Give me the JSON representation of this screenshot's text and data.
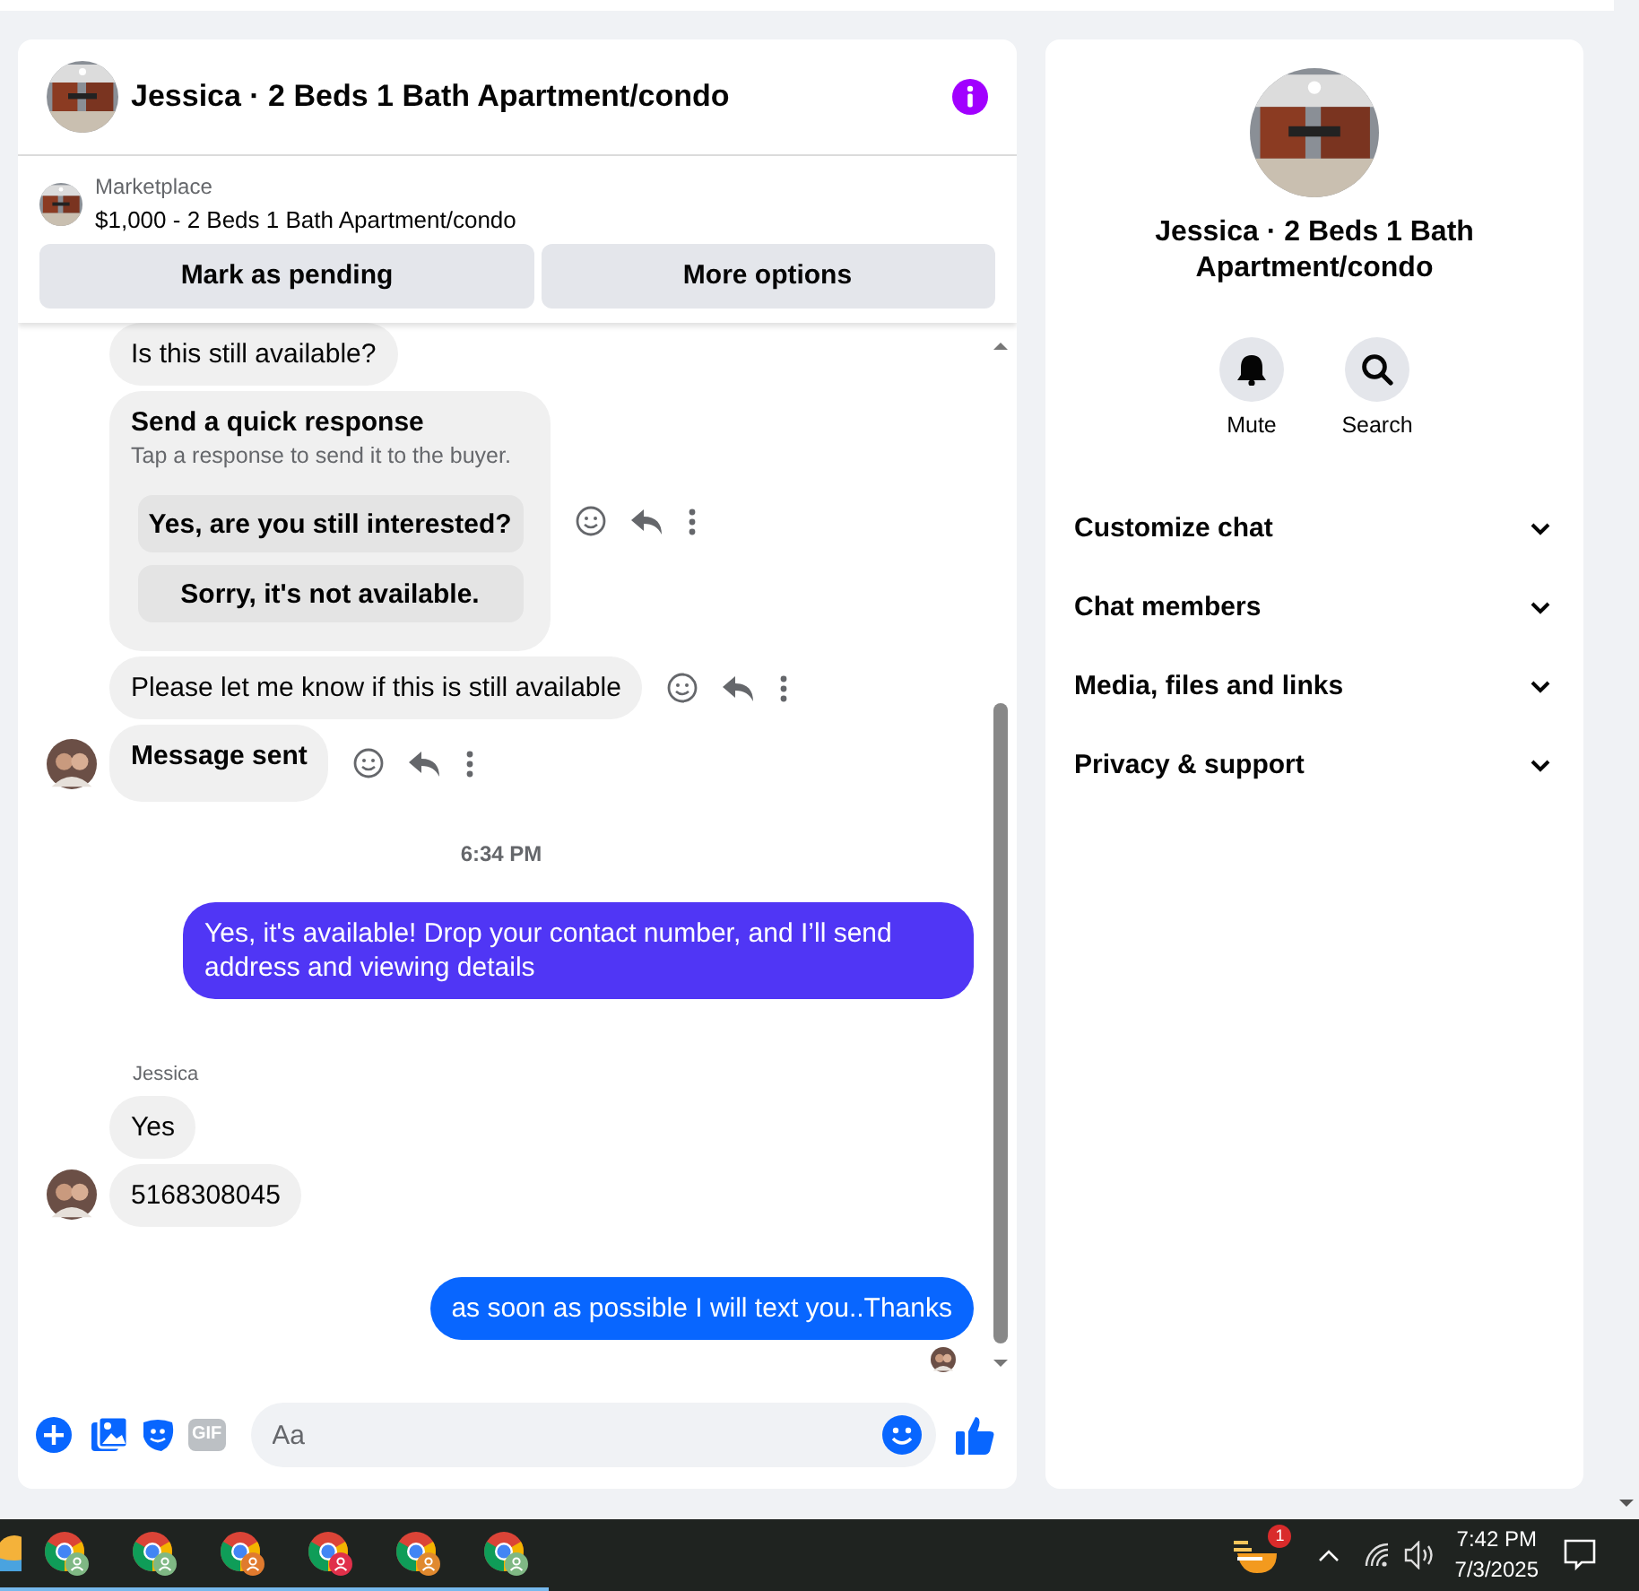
{
  "chat": {
    "title": "Jessica · 2 Beds 1 Bath Apartment/condo",
    "listing": {
      "source": "Marketplace",
      "summary": "$1,000 - 2 Beds 1 Bath Apartment/condo"
    },
    "actions": [
      "Mark as pending",
      "More options"
    ],
    "messages": [
      {
        "kind": "incoming",
        "text": "Is this still available?",
        "avatar": false,
        "tools": false,
        "strong": false
      },
      {
        "kind": "quick",
        "title": "Send a quick response",
        "subtitle": "Tap a response to send it to the buyer.",
        "options": [
          "Yes, are you still interested?",
          "Sorry, it's not available."
        ],
        "tools": true
      },
      {
        "kind": "incoming",
        "text": "Please let me know if this is still available",
        "avatar": false,
        "tools": true,
        "strong": false
      },
      {
        "kind": "incoming",
        "text": "Message sent",
        "avatar": true,
        "tools": true,
        "strong": true
      },
      {
        "kind": "time",
        "text": "6:34 PM"
      },
      {
        "kind": "outgoing",
        "text": "Yes, it's available! Drop your contact number, and I’ll send address and viewing details",
        "color": "#5036f5",
        "seen": false
      },
      {
        "kind": "sender",
        "text": "Jessica"
      },
      {
        "kind": "incoming",
        "text": "Yes",
        "avatar": false,
        "tools": false,
        "strong": false
      },
      {
        "kind": "incoming",
        "text": "5168308045",
        "avatar": true,
        "tools": false,
        "strong": false
      },
      {
        "kind": "outgoing",
        "text": "as soon as possible I will text you..Thanks",
        "color": "#0866ff",
        "seen": true
      }
    ],
    "composer": {
      "gif": "GIF",
      "placeholder": "Aa"
    }
  },
  "info_panel": {
    "title": "Jessica · 2 Beds 1 Bath Apartment/condo",
    "buttons": [
      {
        "kind": "bell",
        "label": "Mute"
      },
      {
        "kind": "search",
        "label": "Search"
      }
    ],
    "sections": [
      {
        "label": "Customize chat",
        "expanded": false
      },
      {
        "label": "Chat members",
        "expanded": false
      },
      {
        "label": "Media, files and links",
        "expanded": false
      },
      {
        "label": "Privacy & support",
        "expanded": false
      }
    ]
  },
  "taskbar": {
    "apps": [
      {
        "kind": "other"
      },
      {
        "kind": "browser",
        "color": "#7fb884"
      },
      {
        "kind": "browser",
        "color": "#7fb884"
      },
      {
        "kind": "browser",
        "color": "#e07a2e"
      },
      {
        "kind": "browser",
        "color": "#e0304a"
      },
      {
        "kind": "browser",
        "color": "#e0892e"
      },
      {
        "kind": "browser",
        "color": "#7fb884"
      }
    ],
    "tray_badge": "1",
    "time": "7:42 PM",
    "date": "7/3/2025"
  }
}
